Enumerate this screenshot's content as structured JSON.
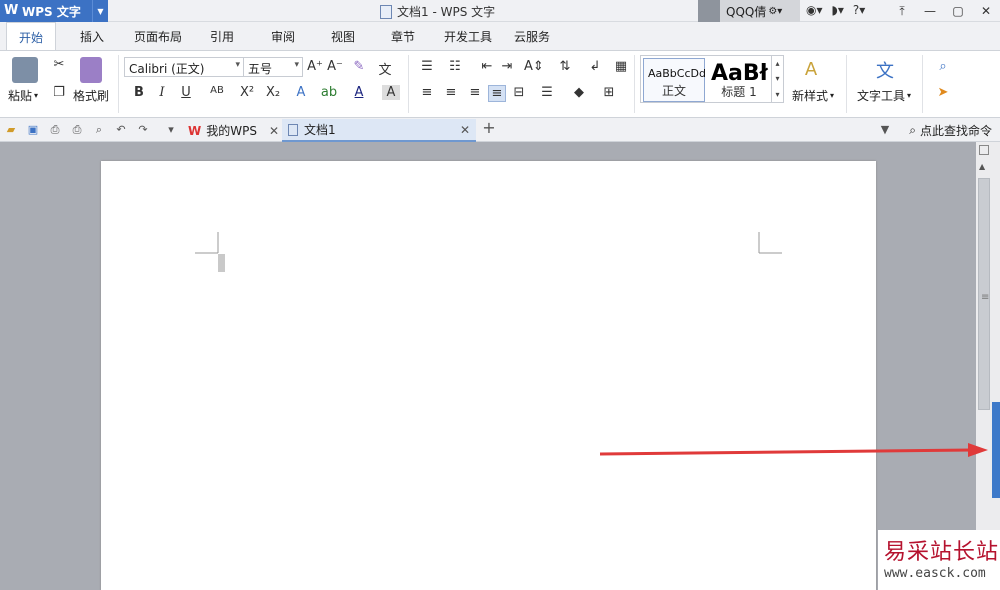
{
  "app": {
    "name": "WPS 文字",
    "window_title": "文档1 - WPS 文字",
    "user": "QQQ倩"
  },
  "menu": {
    "tabs": [
      "开始",
      "插入",
      "页面布局",
      "引用",
      "审阅",
      "视图",
      "章节",
      "开发工具",
      "云服务"
    ],
    "active": "开始"
  },
  "ribbon": {
    "paste": "粘贴",
    "format_painter": "格式刷",
    "font_name": "Calibri (正文)",
    "font_size": "五号",
    "styles": {
      "normal_preview": "AaBbCcDd",
      "normal_label": "正文",
      "heading_preview": "AaBł",
      "heading_label": "标题 1"
    },
    "new_style": "新样式",
    "text_tools": "文字工具"
  },
  "doc_tabs": [
    {
      "label": "我的WPS"
    },
    {
      "label": "文档1",
      "active": true
    }
  ],
  "search_cmd": "点此查找命令",
  "watermark": {
    "title": "易采站长站",
    "url": "www.easck.com"
  },
  "colors": {
    "accent": "#3c72c4",
    "arrow": "#e03a3a",
    "side_tab": "#3d79c9"
  }
}
